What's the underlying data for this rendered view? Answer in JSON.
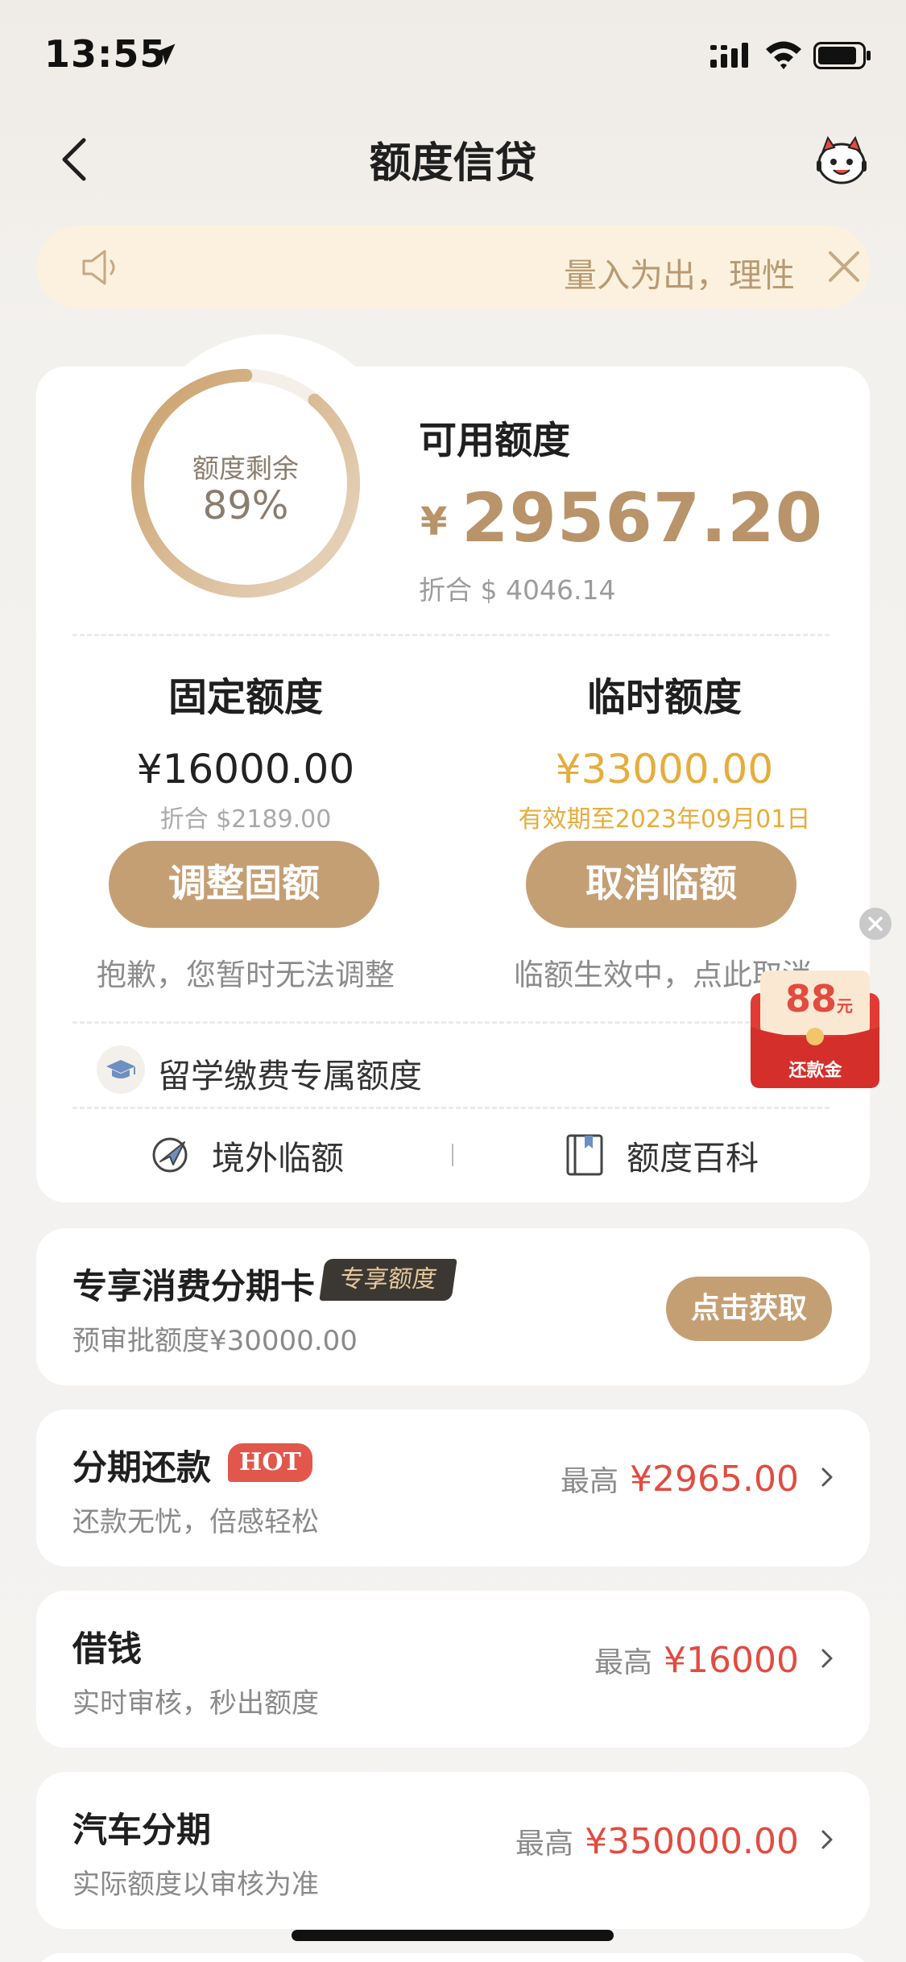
{
  "status_bar": {
    "time": "13:55"
  },
  "nav": {
    "title": "额度信贷"
  },
  "notice": {
    "text": "量入为出，理性"
  },
  "credit": {
    "ring_label": "额度剩余",
    "ring_percent": "89%",
    "ring_fraction": 0.89,
    "available_label": "可用额度",
    "currency": "¥",
    "available_amount": "29567.20",
    "available_usd": "折合 $ 4046.14"
  },
  "fixed": {
    "title": "固定额度",
    "amount": "¥16000.00",
    "usd": "折合 $2189.00",
    "button": "调整固额",
    "note": "抱歉，您暂时无法调整"
  },
  "temp": {
    "title": "临时额度",
    "amount": "¥33000.00",
    "validity": "有效期至2023年09月01日",
    "button": "取消临额",
    "note": "临额生效中，点此取消"
  },
  "study": {
    "label": "留学缴费专属额度"
  },
  "links": [
    {
      "label": "境外临额",
      "icon": "plane-globe-icon"
    },
    {
      "label": "额度百科",
      "icon": "book-icon"
    }
  ],
  "redpacket": {
    "amount": "88",
    "unit": "元",
    "label": "还款金"
  },
  "promo_card": {
    "title": "专享消费分期卡",
    "tag": "专享额度",
    "desc": "预审批额度¥30000.00",
    "button": "点击获取"
  },
  "list": [
    {
      "title": "分期还款",
      "tag": "HOT",
      "desc": "还款无忧，倍感轻松",
      "prefix": "最高",
      "value": "¥2965.00"
    },
    {
      "title": "借钱",
      "desc": "实时审核，秒出额度",
      "prefix": "最高",
      "value": "¥16000"
    },
    {
      "title": "汽车分期",
      "desc": "实际额度以审核为准",
      "prefix": "最高",
      "value": "¥350000.00"
    }
  ],
  "colors": {
    "gold": "#c59f74",
    "amount_gold": "#b9936a",
    "temp_yellow": "#e6ad3c",
    "red": "#e24b41"
  }
}
